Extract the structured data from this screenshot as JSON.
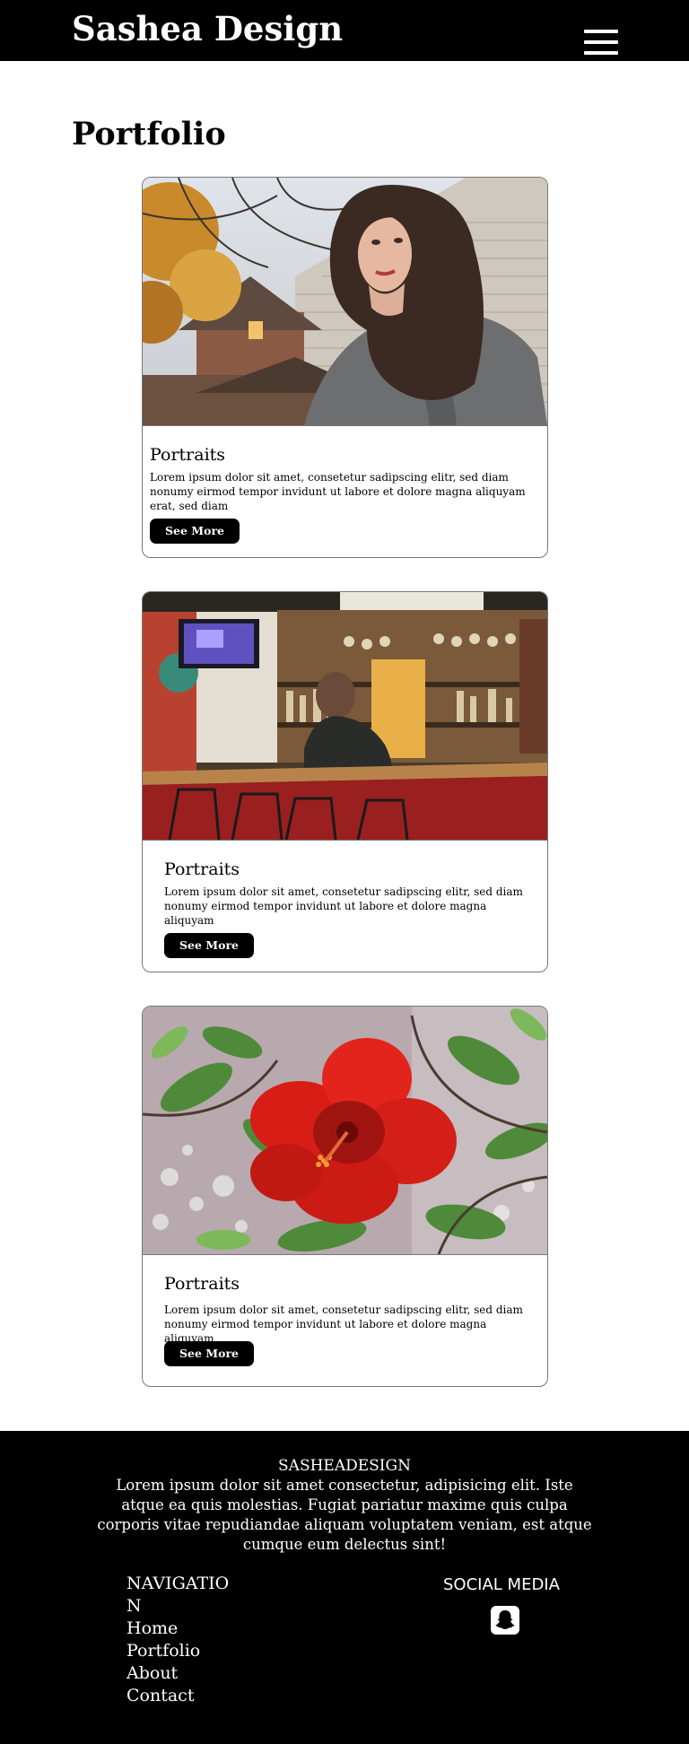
{
  "header": {
    "brand": "Sashea Design",
    "menu_icon": "hamburger-menu-icon"
  },
  "page": {
    "title": "Portfolio"
  },
  "cards": [
    {
      "image": "portrait-woman-curly-hair",
      "title": "Portraits",
      "text": "Lorem ipsum dolor sit amet, consetetur sadipscing elitr, sed diam nonumy eirmod tempor invidunt ut labore et dolore magna aliquyam erat, sed diam",
      "button": "See More"
    },
    {
      "image": "bar-interior-person",
      "title": "Portraits",
      "text": "Lorem ipsum dolor sit amet, consetetur sadipscing elitr, sed diam nonumy eirmod tempor invidunt ut labore et dolore magna aliquyam",
      "button": "See More"
    },
    {
      "image": "red-hibiscus-flower",
      "title": "Portraits",
      "text": "Lorem ipsum dolor sit amet, consetetur sadipscing elitr, sed diam nonumy eirmod tempor invidunt ut labore et dolore magna aliquyam",
      "button": "See More"
    }
  ],
  "footer": {
    "brand": "SASHEADESIGN",
    "text": "Lorem ipsum dolor sit amet consectetur, adipisicing elit. Iste atque ea quis molestias. Fugiat pariatur maxime quis culpa corporis vitae repudiandae aliquam voluptatem veniam, est atque cumque eum delectus sint!",
    "nav_heading": "NAVIGATION",
    "nav_links": [
      "Home",
      "Portfolio",
      "About",
      "Contact"
    ],
    "social_heading": "SOCIAL MEDIA",
    "social_icon": "snapchat-icon"
  },
  "colors": {
    "header_bg": "#000000",
    "footer_bg": "#000000",
    "button_bg": "#000000",
    "button_text": "#ffffff"
  }
}
